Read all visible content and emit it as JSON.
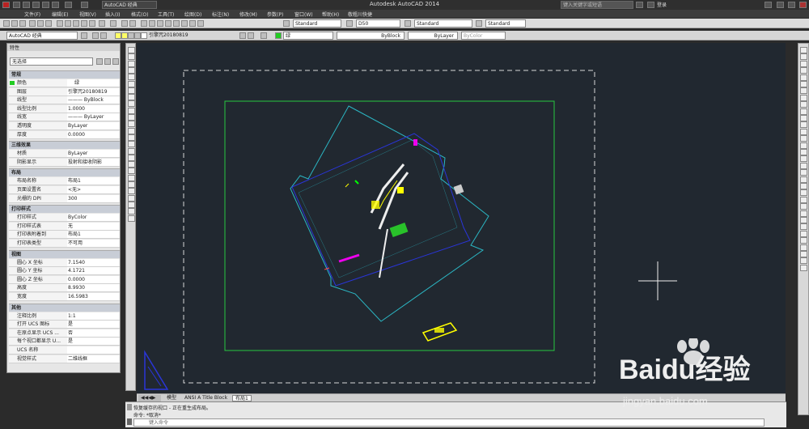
{
  "titlebar": {
    "title": "Autodesk AutoCAD 2014",
    "workspace": "AutoCAD 经典",
    "search_placeholder": "键入关键字或短语",
    "login": "登录"
  },
  "menu": [
    "文件(F)",
    "编辑(E)",
    "视图(V)",
    "插入(I)",
    "格式(O)",
    "工具(T)",
    "绘图(D)",
    "标注(N)",
    "修改(M)",
    "参数(P)",
    "窗口(W)",
    "帮助(H)",
    "敬粗川快捷"
  ],
  "toolbar1": {
    "text_style": "Standard",
    "dim_style": "D50",
    "table_style": "Standard",
    "mleader_style": "Standard"
  },
  "toolbar2": {
    "workspace": "AutoCAD 经典",
    "layer": "引擎咒20180819",
    "color": "绿",
    "linetype": "ByBlock",
    "lineweight": "ByLayer",
    "plotstyle": "ByColor"
  },
  "props": {
    "header": "特性",
    "selection": "无选择",
    "sections": [
      {
        "title": "常规",
        "rows": [
          [
            "颜色",
            "绿"
          ],
          [
            "图层",
            "引擎咒20180819"
          ],
          [
            "线型",
            "——— ByBlock"
          ],
          [
            "线型比例",
            "1.0000"
          ],
          [
            "线宽",
            "——— ByLayer"
          ],
          [
            "透明度",
            "ByLayer"
          ],
          [
            "厚度",
            "0.0000"
          ]
        ]
      },
      {
        "title": "三维效果",
        "rows": [
          [
            "材质",
            "ByLayer"
          ],
          [
            "阴影显示",
            "投射和接收阴影"
          ]
        ]
      },
      {
        "title": "布局",
        "rows": [
          [
            "布局名称",
            "布局1"
          ],
          [
            "页面设置名",
            "<无>"
          ],
          [
            "光栅的 DPI",
            "300"
          ]
        ]
      },
      {
        "title": "打印样式",
        "rows": [
          [
            "打印样式",
            "ByColor"
          ],
          [
            "打印样式表",
            "无"
          ],
          [
            "打印表附着到",
            "布局1"
          ],
          [
            "打印表类型",
            "不可用"
          ]
        ]
      },
      {
        "title": "视图",
        "rows": [
          [
            "圆心 X 坐标",
            "7.1540"
          ],
          [
            "圆心 Y 坐标",
            "4.1721"
          ],
          [
            "圆心 Z 坐标",
            "0.0000"
          ],
          [
            "高度",
            "8.9930"
          ],
          [
            "宽度",
            "16.5983"
          ]
        ]
      },
      {
        "title": "其他",
        "rows": [
          [
            "注释比例",
            "1:1"
          ],
          [
            "打开 UCS 图标",
            "是"
          ],
          [
            "在原点显示 UCS ...",
            "否"
          ],
          [
            "每个视口都显示 U...",
            "是"
          ],
          [
            "UCS 名称",
            ""
          ],
          [
            "视觉样式",
            "二维线框"
          ]
        ]
      }
    ]
  },
  "tabs": [
    "模型",
    "ANSI A Title Block",
    "布局1"
  ],
  "command": {
    "line1": "恢复缓存的视口 - 正在重生成布局。",
    "line2": "命令: *取消*",
    "placeholder": "键入命令"
  },
  "watermark": {
    "brand": "Baidu经验",
    "url": "jingyan.baidu.com"
  }
}
